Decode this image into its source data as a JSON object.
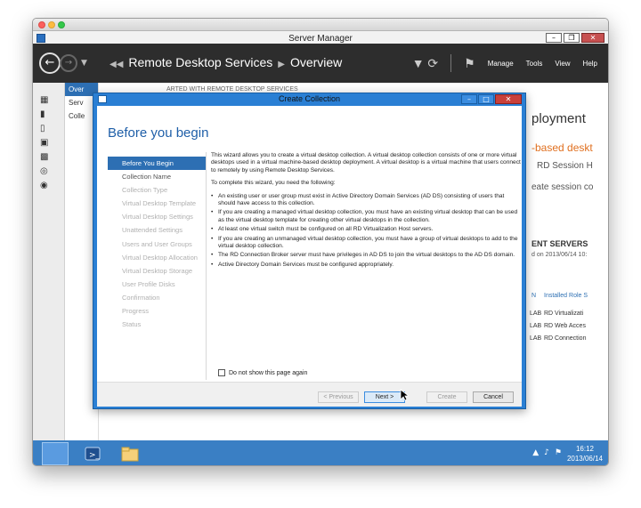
{
  "window": {
    "title": "Server Manager",
    "nav": {
      "breadcrumb_section": "Remote Desktop Services",
      "breadcrumb_page": "Overview",
      "menus": [
        "Manage",
        "Tools",
        "View",
        "Help"
      ]
    }
  },
  "nav_list": [
    "Over",
    "Serv",
    "Colle"
  ],
  "background": {
    "started_header": "ARTED WITH REMOTE DESKTOP SERVICES",
    "deployment": "ployment",
    "based_desk": "-based deskt",
    "rd_session": "RD Session H",
    "create_session": "eate session co",
    "servers_header": "ENT SERVERS",
    "servers_date": "d on 2013/06/14 10:",
    "installed_role": "Installed Role S",
    "roles": [
      "RD Virtualizati",
      "RD Web Acces",
      "RD Connection"
    ],
    "n_col": "N",
    "lab": [
      "LAB",
      "LAB",
      "LAB"
    ]
  },
  "dialog": {
    "title": "Create Collection",
    "header": "Before you begin",
    "steps": [
      {
        "label": "Before You Begin",
        "state": "active"
      },
      {
        "label": "Collection Name",
        "state": "done"
      },
      {
        "label": "Collection Type",
        "state": "pending"
      },
      {
        "label": "Virtual Desktop Template",
        "state": "pending"
      },
      {
        "label": "Virtual Desktop Settings",
        "state": "pending"
      },
      {
        "label": "Unattended Settings",
        "state": "pending"
      },
      {
        "label": "Users and User Groups",
        "state": "pending"
      },
      {
        "label": "Virtual Desktop Allocation",
        "state": "pending"
      },
      {
        "label": "Virtual Desktop Storage",
        "state": "pending"
      },
      {
        "label": "User Profile Disks",
        "state": "pending"
      },
      {
        "label": "Confirmation",
        "state": "pending"
      },
      {
        "label": "Progress",
        "state": "pending"
      },
      {
        "label": "Status",
        "state": "pending"
      }
    ],
    "intro": "This wizard allows you to create a virtual desktop collection. A virtual desktop collection consists of one or more virtual desktops used in a virtual machine-based desktop deployment. A virtual desktop is a virtual machine that users connect to remotely by using Remote Desktop Services.",
    "requirements_intro": "To complete this wizard, you need the following:",
    "requirements": [
      "An existing user or user group must exist in Active Directory Domain Services (AD DS) consisting of users that should have access to this collection.",
      "If you are creating a managed virtual desktop collection, you must have an existing virtual desktop that can be used as the virtual desktop template for creating other virtual desktops in the collection.",
      "At least one virtual switch must be configured on all RD Virtualization Host servers.",
      "If you are creating an unmanaged virtual desktop collection, you must have a group of virtual desktops to add to the virtual desktop collection.",
      "The RD Connection Broker server must have privileges in AD DS to join the virtual desktops to the AD DS domain.",
      "Active Directory Domain Services must be configured appropriately."
    ],
    "no_show_label": "Do not show this page again",
    "buttons": {
      "previous": "< Previous",
      "next": "Next >",
      "create": "Create",
      "cancel": "Cancel"
    }
  },
  "taskbar": {
    "time": "16:12",
    "date": "2013/06/14"
  }
}
